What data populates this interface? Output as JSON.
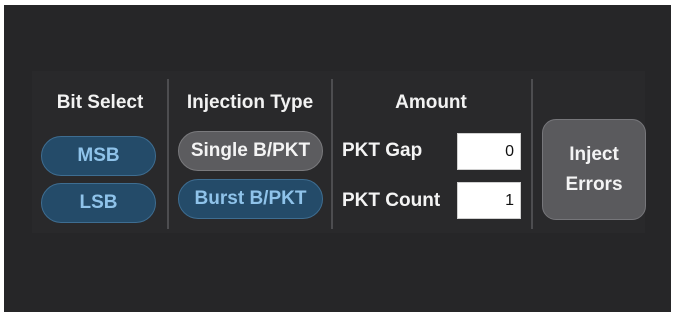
{
  "bit_select": {
    "heading": "Bit Select",
    "msb_label": "MSB",
    "lsb_label": "LSB"
  },
  "injection_type": {
    "heading": "Injection Type",
    "single_label": "Single B/PKT",
    "burst_label": "Burst B/PKT"
  },
  "amount": {
    "heading": "Amount",
    "pkt_gap_label": "PKT Gap",
    "pkt_gap_value": "0",
    "pkt_count_label": "PKT Count",
    "pkt_count_value": "1"
  },
  "inject": {
    "line1": "Inject",
    "line2": "Errors"
  },
  "colors": {
    "background": "#262628",
    "blue_button": "#244b69",
    "blue_text": "#8fc3ea",
    "gray_button": "#5c5c5f"
  }
}
